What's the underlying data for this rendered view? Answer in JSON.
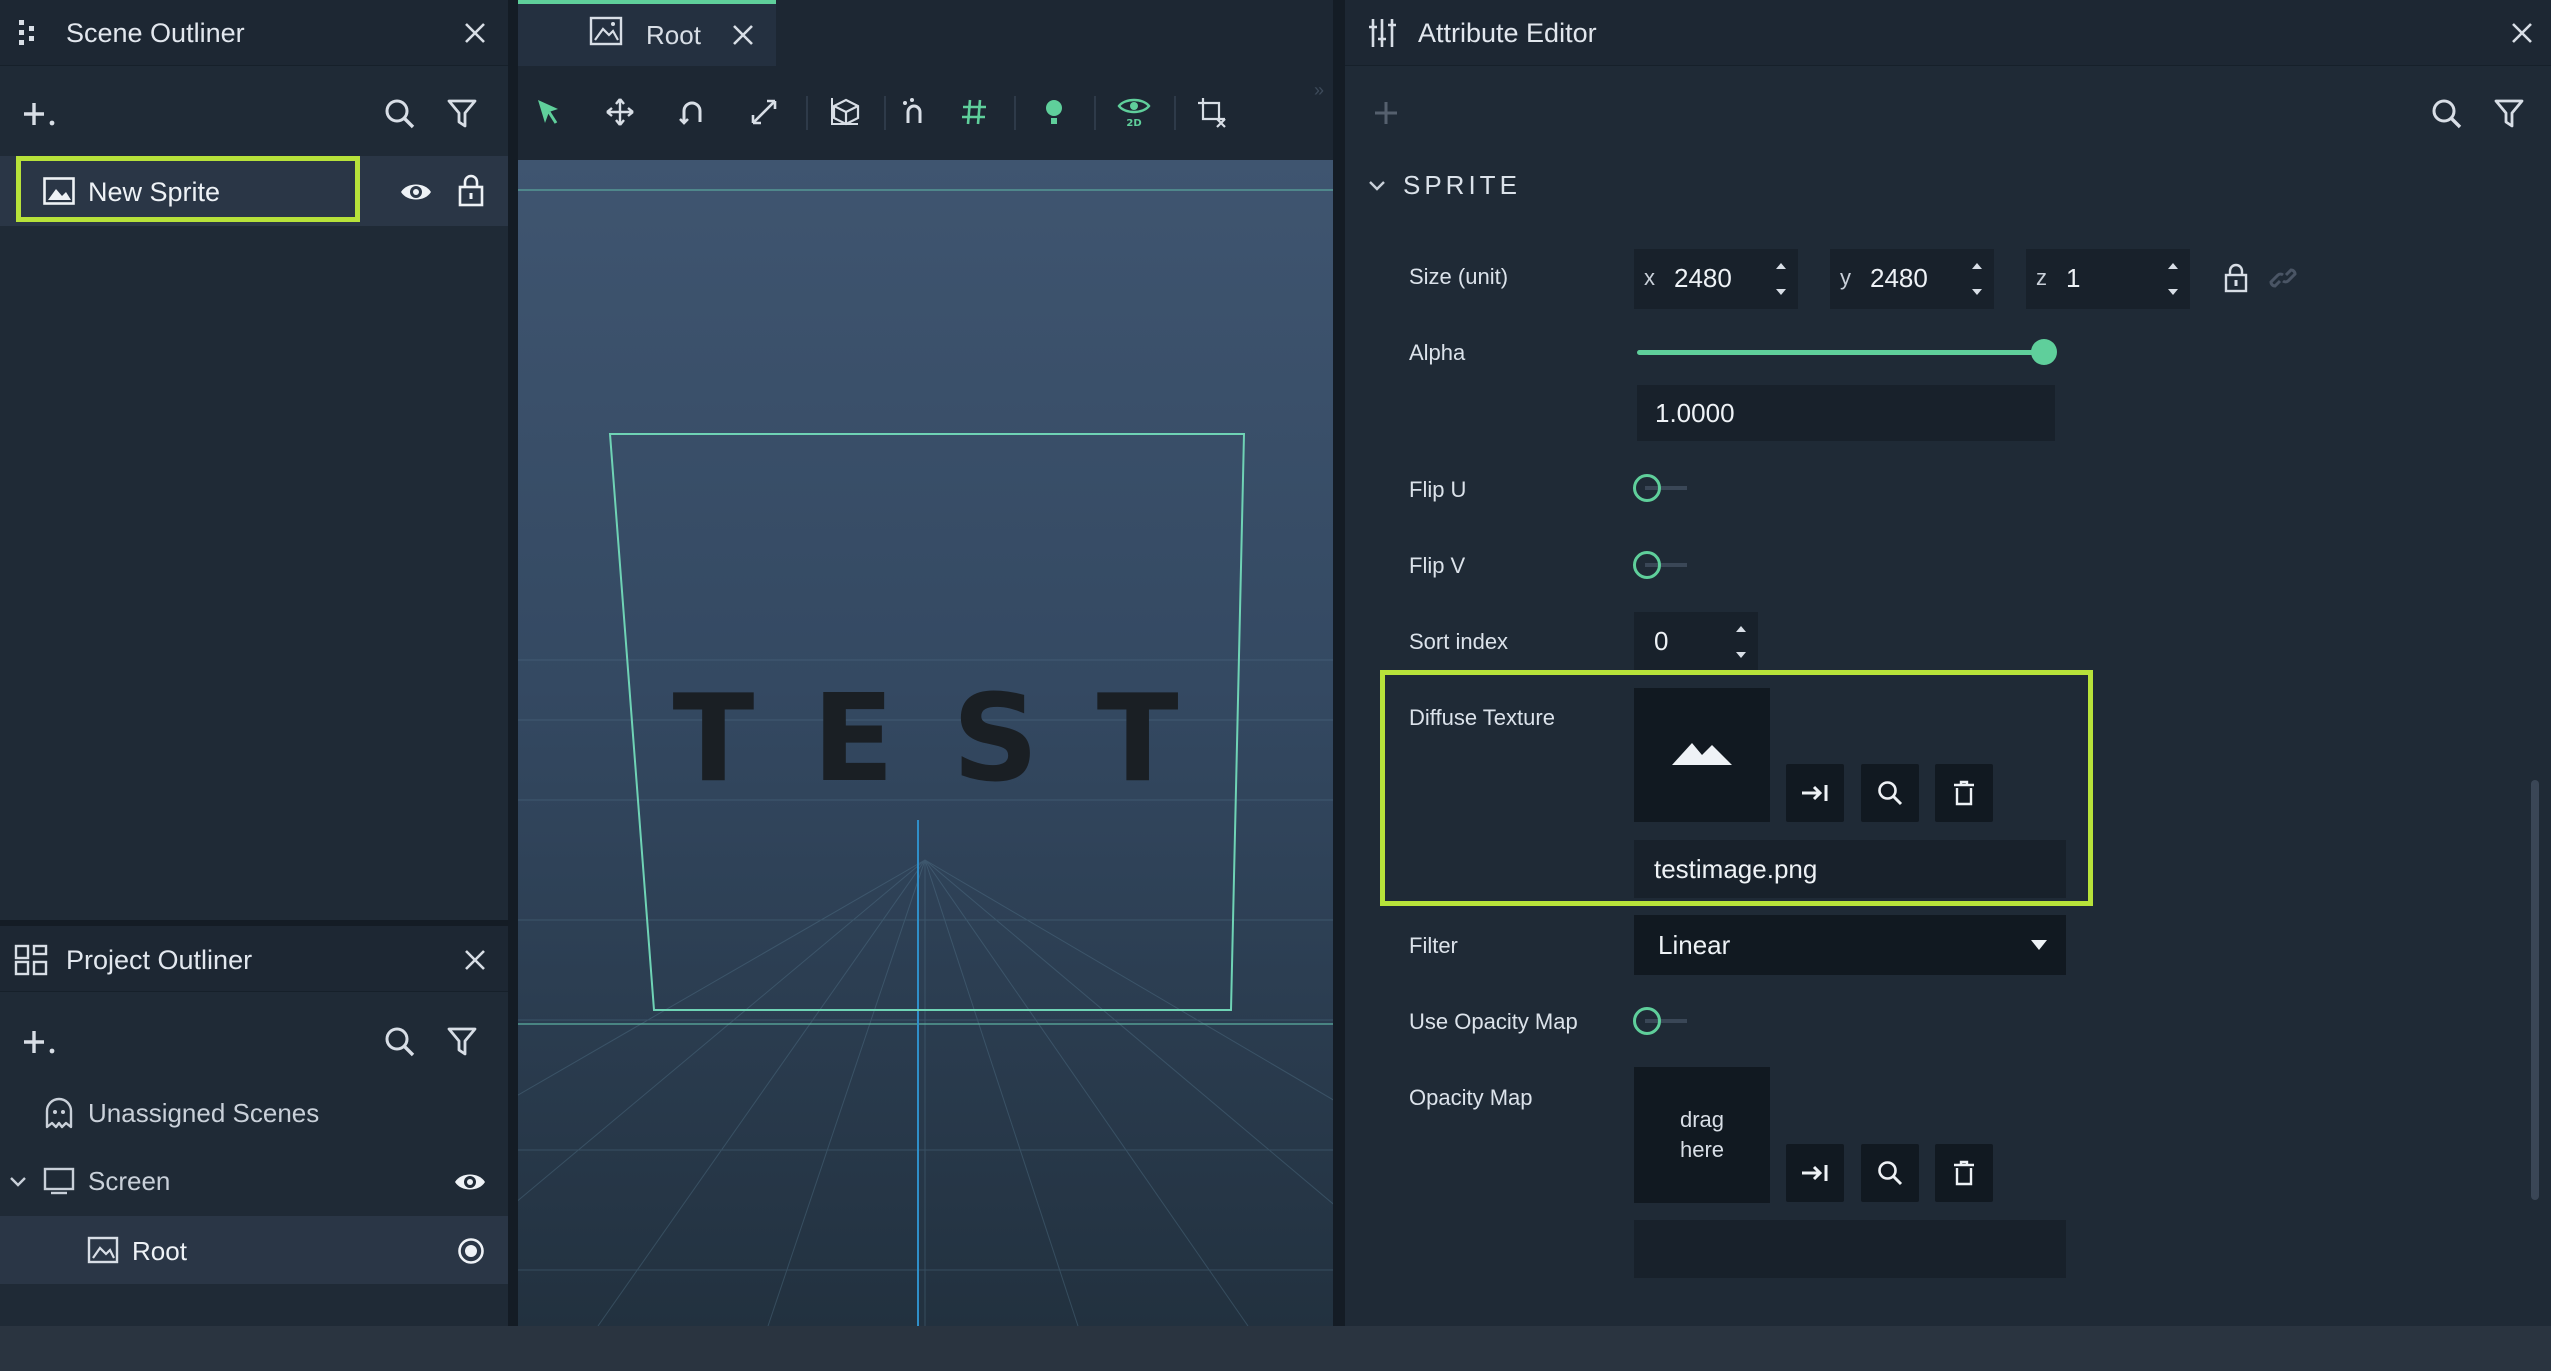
{
  "scene_outliner": {
    "title": "Scene Outliner",
    "items": [
      {
        "label": "New Sprite",
        "selected": true
      }
    ]
  },
  "project_outliner": {
    "title": "Project Outliner",
    "items": [
      {
        "label": "Unassigned Scenes"
      },
      {
        "label": "Screen"
      },
      {
        "label": "Root"
      }
    ]
  },
  "viewport": {
    "tab_label": "Root",
    "scene_text": "TEST",
    "toolbar_icons": [
      "select-icon",
      "move-icon",
      "rotate-icon",
      "scale-icon",
      "cube-view-icon",
      "snap-icon",
      "grid-icon",
      "light-icon",
      "view-2d-icon",
      "crop-icon"
    ]
  },
  "attribute_editor": {
    "title": "Attribute Editor",
    "section": "SPRITE",
    "size": {
      "label": "Size (unit)",
      "x_label": "x",
      "x": "2480",
      "y_label": "y",
      "y": "2480",
      "z_label": "z",
      "z": "1"
    },
    "alpha": {
      "label": "Alpha",
      "value": "1.0000",
      "level": 1.0
    },
    "flip_u": {
      "label": "Flip U",
      "on": false
    },
    "flip_v": {
      "label": "Flip V",
      "on": false
    },
    "sort_index": {
      "label": "Sort index",
      "value": "0"
    },
    "diffuse_texture": {
      "label": "Diffuse Texture",
      "file": "testimage.png"
    },
    "filter": {
      "label": "Filter",
      "value": "Linear"
    },
    "use_opacity_map": {
      "label": "Use Opacity Map",
      "on": false
    },
    "opacity_map": {
      "label": "Opacity Map",
      "drop_text": "drag\nhere",
      "file": ""
    }
  },
  "colors": {
    "accent": "#5fcf9b",
    "highlight": "#b7e23a",
    "panel": "#1f2a36"
  }
}
